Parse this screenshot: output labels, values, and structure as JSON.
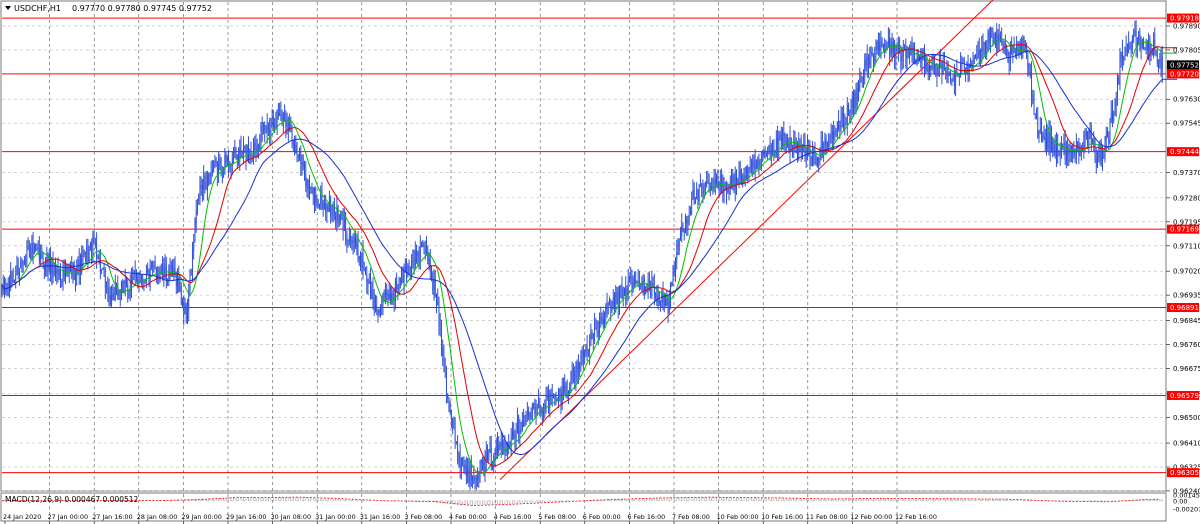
{
  "header": {
    "symbol": "USDCHF,H1",
    "ohlc": "0.97770 0.97780 0.97745 0.97752"
  },
  "colors": {
    "background": "#ffffff",
    "grid": "#b8b8b8",
    "candles": "#2f4fd8",
    "level_line": "#ff0000",
    "ma_fast": "#00c000",
    "ma_mid": "#e00000",
    "ma_slow": "#1a2fd0",
    "macd_hist": "#bfbfbf",
    "macd_signal": "#ff0000",
    "label_red_bg": "#ff0000",
    "label_black_bg": "#000000"
  },
  "chart_data": [
    {
      "type": "candlestick",
      "ylim": [
        0.9624,
        0.97975
      ],
      "y_ticks": [
        "0.97890",
        "0.97805",
        "0.97630",
        "0.97545",
        "0.97370",
        "0.97280",
        "0.97195",
        "0.97110",
        "0.97020",
        "0.96935",
        "0.96845",
        "0.96760",
        "0.96675",
        "0.96585",
        "0.96500",
        "0.96410",
        "0.96325",
        "0.96240"
      ],
      "x_tick_labels": [
        "24 Jan 2020",
        "27 Jan 00:00",
        "27 Jan 16:00",
        "28 Jan 08:00",
        "29 Jan 00:00",
        "29 Jan 16:00",
        "30 Jan 08:00",
        "31 Jan 00:00",
        "31 Jan 16:00",
        "3 Feb 08:00",
        "4 Feb 00:00",
        "4 Feb 16:00",
        "5 Feb 08:00",
        "6 Feb 00:00",
        "6 Feb 16:00",
        "7 Feb 08:00",
        "10 Feb 00:00",
        "10 Feb 16:00",
        "11 Feb 08:00",
        "12 Feb 00:00",
        "12 Feb 16:00"
      ],
      "price_levels": [
        {
          "value": 0.97918,
          "label": "0.97918"
        },
        {
          "value": 0.9772,
          "label": "0.97720"
        },
        {
          "value": 0.97444,
          "label": "0.97444"
        },
        {
          "value": 0.97169,
          "label": "0.97169"
        },
        {
          "value": 0.96891,
          "label": "0.96891"
        },
        {
          "value": 0.96579,
          "label": "0.96579"
        },
        {
          "value": 0.96305,
          "label": "0.96305"
        }
      ],
      "current_price": {
        "value": 0.97752,
        "label": "0.97752"
      },
      "trendline": {
        "start": {
          "bar": 400,
          "price": 0.9628
        },
        "end": {
          "bar": 800,
          "price": 0.98
        }
      },
      "price_path": [
        [
          0,
          0.9694
        ],
        [
          10,
          0.97
        ],
        [
          20,
          0.971
        ],
        [
          35,
          0.9705
        ],
        [
          50,
          0.97
        ],
        [
          60,
          0.9703
        ],
        [
          75,
          0.9712
        ],
        [
          85,
          0.9692
        ],
        [
          95,
          0.9695
        ],
        [
          110,
          0.97
        ],
        [
          125,
          0.9702
        ],
        [
          140,
          0.97
        ],
        [
          148,
          0.9685
        ],
        [
          158,
          0.973
        ],
        [
          170,
          0.9738
        ],
        [
          185,
          0.9742
        ],
        [
          200,
          0.9745
        ],
        [
          212,
          0.9752
        ],
        [
          222,
          0.9758
        ],
        [
          230,
          0.9755
        ],
        [
          240,
          0.974
        ],
        [
          250,
          0.9728
        ],
        [
          262,
          0.9725
        ],
        [
          275,
          0.9718
        ],
        [
          290,
          0.9705
        ],
        [
          300,
          0.9688
        ],
        [
          315,
          0.9695
        ],
        [
          330,
          0.9706
        ],
        [
          340,
          0.971
        ],
        [
          350,
          0.969
        ],
        [
          358,
          0.9658
        ],
        [
          365,
          0.9638
        ],
        [
          375,
          0.963
        ],
        [
          385,
          0.9632
        ],
        [
          395,
          0.9638
        ],
        [
          405,
          0.9642
        ],
        [
          420,
          0.965
        ],
        [
          435,
          0.9655
        ],
        [
          450,
          0.9658
        ],
        [
          462,
          0.9668
        ],
        [
          475,
          0.968
        ],
        [
          490,
          0.969
        ],
        [
          505,
          0.9698
        ],
        [
          520,
          0.9696
        ],
        [
          535,
          0.969
        ],
        [
          545,
          0.9715
        ],
        [
          555,
          0.9728
        ],
        [
          570,
          0.9732
        ],
        [
          590,
          0.9734
        ],
        [
          610,
          0.974
        ],
        [
          625,
          0.9748
        ],
        [
          640,
          0.9745
        ],
        [
          655,
          0.9742
        ],
        [
          670,
          0.9752
        ],
        [
          685,
          0.9762
        ],
        [
          695,
          0.9778
        ],
        [
          710,
          0.9782
        ],
        [
          730,
          0.9778
        ],
        [
          750,
          0.9775
        ],
        [
          765,
          0.977
        ],
        [
          780,
          0.9778
        ],
        [
          795,
          0.9785
        ],
        [
          810,
          0.9778
        ],
        [
          822,
          0.9782
        ],
        [
          832,
          0.9752
        ],
        [
          845,
          0.9746
        ],
        [
          860,
          0.9744
        ],
        [
          872,
          0.975
        ],
        [
          880,
          0.974
        ],
        [
          890,
          0.9752
        ],
        [
          900,
          0.978
        ],
        [
          910,
          0.9784
        ],
        [
          925,
          0.9781
        ],
        [
          932,
          0.9775
        ]
      ],
      "macd": {
        "label": "MACD(12,26,9) 0.000467 0.000512",
        "ylim": [
          -0.002078,
          0.001458
        ],
        "y_ticks": [
          "0.001458",
          "0.00",
          "-0.002078"
        ],
        "path": [
          [
            0,
            2e-05
          ],
          [
            60,
            0.0001
          ],
          [
            120,
            5e-05
          ],
          [
            150,
            0.0003
          ],
          [
            180,
            0.0008
          ],
          [
            230,
            0.0009
          ],
          [
            260,
            0.0006
          ],
          [
            300,
            0.0
          ],
          [
            340,
            -0.0002
          ],
          [
            370,
            -0.0012
          ],
          [
            400,
            -0.0009
          ],
          [
            440,
            -0.0003
          ],
          [
            480,
            0.0003
          ],
          [
            520,
            0.0007
          ],
          [
            560,
            0.0009
          ],
          [
            620,
            0.0007
          ],
          [
            660,
            0.00045
          ],
          [
            700,
            0.0006
          ],
          [
            760,
            0.0005
          ],
          [
            800,
            0.0004
          ],
          [
            840,
            -0.0001
          ],
          [
            880,
            -0.00025
          ],
          [
            910,
            0.0003
          ],
          [
            932,
            0.00047
          ]
        ]
      }
    }
  ]
}
